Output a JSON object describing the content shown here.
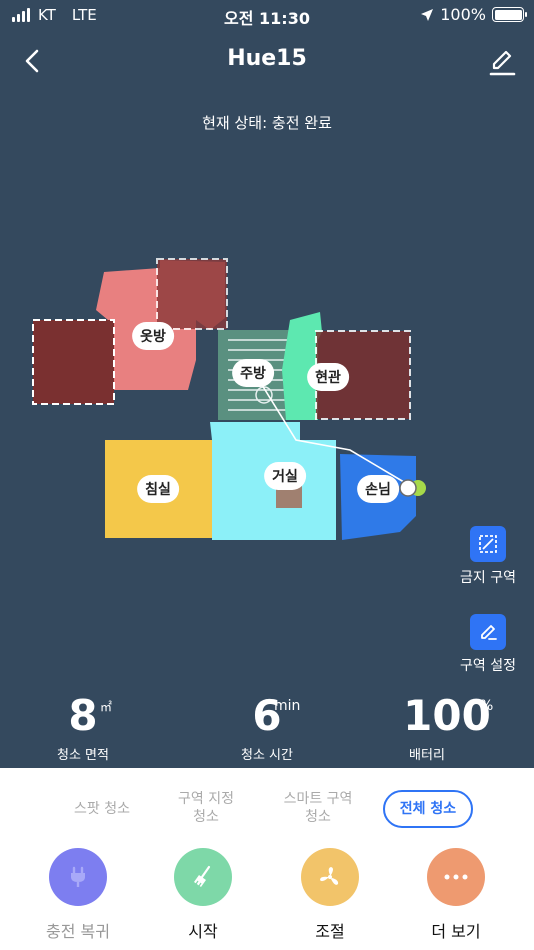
{
  "status_bar": {
    "carrier": "KT",
    "network": "LTE",
    "time": "오전 11:30",
    "battery": "100%"
  },
  "header": {
    "title": "Hue15"
  },
  "robot_status": "현재 상태: 충전 완료",
  "map": {
    "rooms": [
      {
        "name": "옷방",
        "color": "#e88080"
      },
      {
        "name": "주방",
        "color": "#5a9080"
      },
      {
        "name": "현관",
        "color": "#5de8b0"
      },
      {
        "name": "침실",
        "color": "#f4c84a"
      },
      {
        "name": "거실",
        "color": "#8cf0f8"
      },
      {
        "name": "손님",
        "color": "#2f7ae8"
      }
    ],
    "no_go_color": "#8b3a3a"
  },
  "side_buttons": {
    "no_go_zone": "금지 구역",
    "zone_settings": "구역 설정"
  },
  "stats": {
    "area": {
      "value": "8",
      "unit": "㎡",
      "label": "청소 면적"
    },
    "time": {
      "value": "6",
      "unit": "min",
      "label": "청소 시간"
    },
    "battery": {
      "value": "100",
      "unit": "%",
      "label": "배터리"
    }
  },
  "modes": {
    "spot": "스팟 청소",
    "zone_line1": "구역 지정",
    "zone_line2": "청소",
    "smart_line1": "스마트 구역",
    "smart_line2": "청소",
    "full": "전체 청소"
  },
  "actions": {
    "dock": {
      "label": "충전 복귀",
      "color": "#7d7ef0"
    },
    "start": {
      "label": "시작",
      "color": "#7ed8a8"
    },
    "adjust": {
      "label": "조절",
      "color": "#f2c46a"
    },
    "more": {
      "label": "더 보기",
      "color": "#ee9a70"
    }
  },
  "accent_color": "#2f74f5"
}
